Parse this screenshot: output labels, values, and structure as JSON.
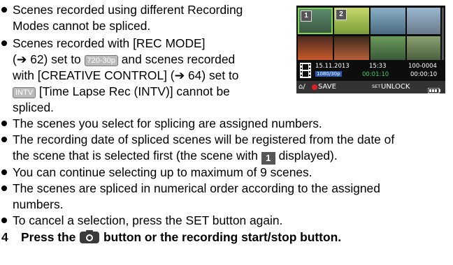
{
  "bullets_top": [
    [
      "Scenes recorded using different Recording",
      "Modes cannot be spliced."
    ],
    [
      "Scenes recorded with [REC MODE]",
      "(➔ 62) set to",
      "and scenes recorded",
      "with [CREATIVE CONTROL] (➔ 64) set to",
      "[Time Lapse Rec (INTV)] cannot be",
      "spliced."
    ]
  ],
  "icons": {
    "rec_mode": "720-30p",
    "intv": "INTV",
    "scene_one": "1"
  },
  "bullets_bottom": [
    [
      "The scenes you select for splicing are assigned numbers."
    ],
    [
      "The recording date of spliced scenes will be registered from the date of",
      "the scene that is selected first (the scene with",
      "displayed)."
    ],
    [
      "You can continue selecting up to maximum of 9 scenes."
    ],
    [
      "The scenes are spliced in numerical order according to the assigned",
      "numbers."
    ],
    [
      "To cancel a selection, press the SET button again."
    ]
  ],
  "step": {
    "number": "4",
    "before": "Press the",
    "after": "button or the recording start/stop button."
  },
  "screen": {
    "thumb1_num": "1",
    "thumb2_num": "2",
    "date": "15.11.2013",
    "time": "15:33",
    "file": "100-0004",
    "mode_badge": "1080/30p",
    "elapsed": "00:01:10",
    "total": "00:00:10",
    "save_label": "SAVE",
    "unlock_label": "UNLOCK",
    "set_prefix": "SET",
    "colors": {
      "select_frame": "#7fd84a",
      "green_text": "#39d46a"
    }
  }
}
